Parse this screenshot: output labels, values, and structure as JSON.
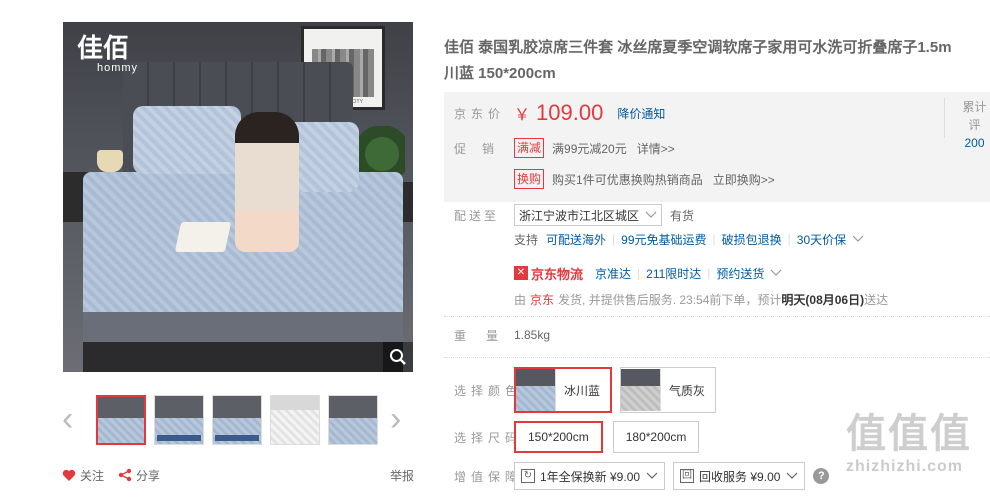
{
  "gallery": {
    "logo_mark": "佳佰",
    "logo_sub": "hommy",
    "frame_text": "NEW YORK CITY",
    "thumbnails": [
      "1",
      "2",
      "3",
      "4",
      "5"
    ],
    "prev_arrow": "‹",
    "next_arrow": "›"
  },
  "actions": {
    "follow": "关注",
    "share": "分享",
    "report": "举报"
  },
  "product": {
    "title_line1": "佳佰 泰国乳胶凉席三件套 冰丝席夏季空调软席子家用可水洗可折叠席子1.5m",
    "title_line2": "川蓝 150*200cm"
  },
  "price": {
    "label": "京东价",
    "symbol": "￥",
    "value": "109.00",
    "notify": "降价通知",
    "cum_label": "累计评",
    "cum_value": "200"
  },
  "promo": {
    "label": "促销",
    "items": [
      {
        "tag": "满减",
        "text": "满99元减20元",
        "link": "详情>>"
      },
      {
        "tag": "换购",
        "text": "购买1件可优惠换购热销商品",
        "link": "立即换购>>"
      }
    ]
  },
  "delivery": {
    "label": "配送至",
    "address": "浙江宁波市江北区城区",
    "stock": "有货",
    "support_label": "支持",
    "supports": [
      "可配送海外",
      "99元免基础运费",
      "破损包退换",
      "30天价保"
    ],
    "logistics_name": "京东物流",
    "logistics_items": [
      "京准达",
      "211限时达",
      "预约送货"
    ],
    "ship_prefix": "由",
    "ship_seller": "京东",
    "ship_text": "发货, 并提供售后服务. 23:54前下单，预计",
    "ship_date": "明天(08月06日)",
    "ship_suffix": "送达"
  },
  "weight": {
    "label": "重量",
    "value": "1.85kg"
  },
  "colors": {
    "label": "选择颜色",
    "options": [
      {
        "name": "冰川蓝",
        "selected": true
      },
      {
        "name": "气质灰",
        "selected": false
      }
    ]
  },
  "sizes": {
    "label": "选择尺码",
    "options": [
      {
        "name": "150*200cm",
        "selected": true
      },
      {
        "name": "180*200cm",
        "selected": false
      }
    ]
  },
  "services": {
    "label": "增值保障",
    "items": [
      {
        "icon": "↻",
        "text": "1年全保换新 ¥9.00"
      },
      {
        "icon": "回",
        "text": "回收服务 ¥9.00"
      }
    ],
    "help": "?"
  },
  "watermark": {
    "big": "值值值",
    "small": "zhizhizhi.com"
  },
  "theme": {
    "accent": "#e4393c",
    "link": "#005aa0",
    "summary_bg": "#f3f3f3"
  }
}
